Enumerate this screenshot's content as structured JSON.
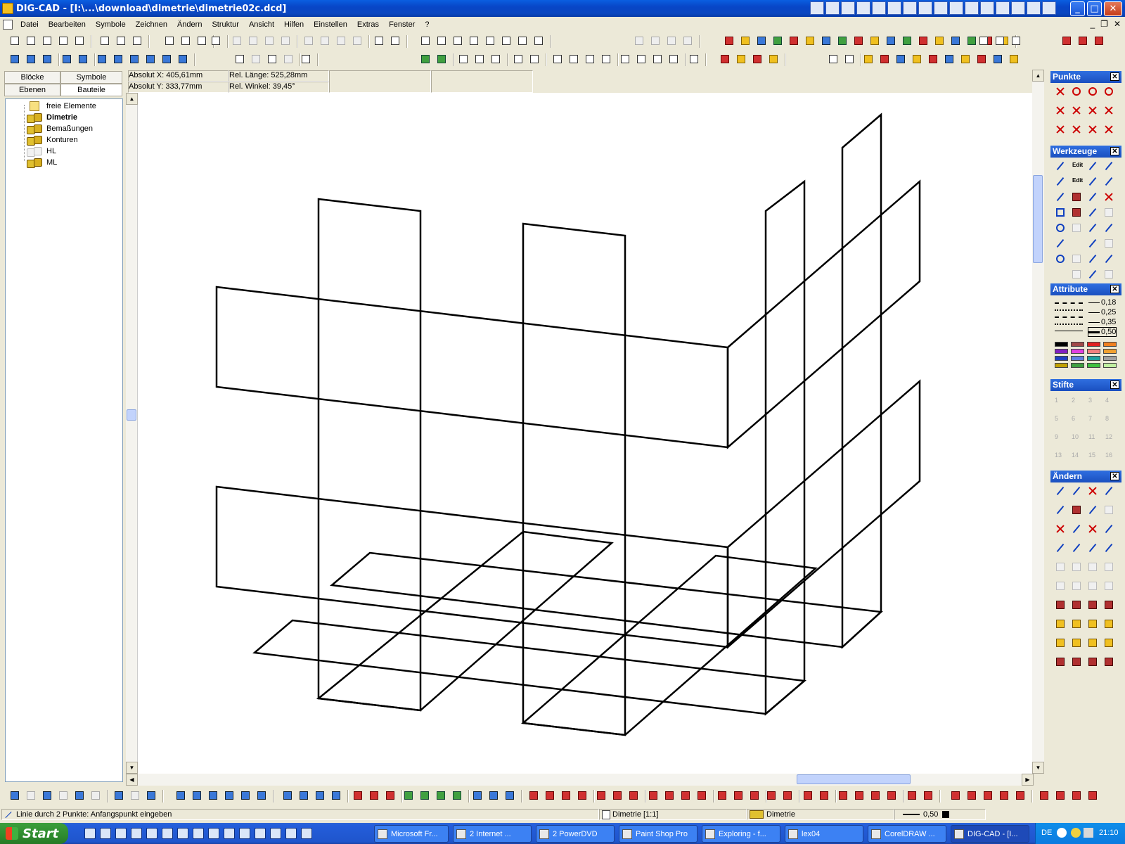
{
  "window": {
    "title": "DIG-CAD - [I:\\...\\download\\dimetrie\\dimetrie02c.dcd]",
    "minimize_glyph": "_",
    "maximize_glyph": "□",
    "close_glyph": "✕"
  },
  "menu": {
    "items": [
      "Datei",
      "Bearbeiten",
      "Symbole",
      "Zeichnen",
      "Ändern",
      "Struktur",
      "Ansicht",
      "Hilfen",
      "Einstellen",
      "Extras",
      "Fenster",
      "?"
    ],
    "mdi_minimize": "_",
    "mdi_restore": "❐",
    "mdi_close": "✕"
  },
  "coords": {
    "abs_x_label": "Absolut X:",
    "abs_x_value": "405,61mm",
    "abs_y_label": "Absolut Y:",
    "abs_y_value": "333,77mm",
    "rel_len_label": "Rel. Länge:",
    "rel_len_value": "525,28mm",
    "rel_angle_label": "Rel. Winkel:",
    "rel_angle_value": "39,45°"
  },
  "left_panel": {
    "tabs": [
      "Blöcke",
      "Symbole",
      "Ebenen",
      "Bauteile"
    ],
    "tree": [
      {
        "label": "freie Elemente",
        "icon": "folder-icon",
        "bold": false
      },
      {
        "label": "Dimetrie",
        "icon": "layer-icon",
        "bold": true
      },
      {
        "label": "Bemaßungen",
        "icon": "layer-icon",
        "bold": false
      },
      {
        "label": "Konturen",
        "icon": "layer-icon",
        "bold": false
      },
      {
        "label": "HL",
        "icon": "layer-hidden-icon",
        "bold": false
      },
      {
        "label": "ML",
        "icon": "layer-icon",
        "bold": false
      }
    ]
  },
  "palettes": {
    "punkte": "Punkte",
    "werkzeuge": "Werkzeuge",
    "attribute": "Attribute",
    "stifte": "Stifte",
    "aendern": "Ändern",
    "close_glyph": "✕",
    "edit1": "Edit",
    "edit2": "Edit",
    "line_widths": [
      "0,18",
      "0,25",
      "0,35",
      "0,50"
    ],
    "colors": [
      "#000000",
      "#a04848",
      "#e02020",
      "#f08020",
      "#8020c0",
      "#e040e0",
      "#f08080",
      "#f0a030",
      "#2040c0",
      "#6080e0",
      "#20a0a0",
      "#a0a0a0",
      "#c0a000",
      "#40a040",
      "#40c040",
      "#c0f0a0"
    ],
    "pens": [
      "1",
      "2",
      "3",
      "4",
      "5",
      "6",
      "7",
      "8",
      "9",
      "10",
      "11",
      "12",
      "13",
      "14",
      "15",
      "16"
    ]
  },
  "status": {
    "hint": "Linie durch 2 Punkte: Anfangspunkt eingeben",
    "view": "Dimetrie [1:1]",
    "layer": "Dimetrie",
    "line_width": "0,50"
  },
  "taskbar": {
    "start": "Start",
    "tasks": [
      "Microsoft Fr...",
      "2 Internet ...",
      "2 PowerDVD",
      "Paint Shop Pro",
      "Exploring - f...",
      "lex04",
      "CorelDRAW ...",
      "DIG-CAD - [I..."
    ],
    "lang": "DE",
    "clock": "21:10"
  },
  "drawing": {
    "stroke_color": "#000000",
    "units": "mm"
  }
}
